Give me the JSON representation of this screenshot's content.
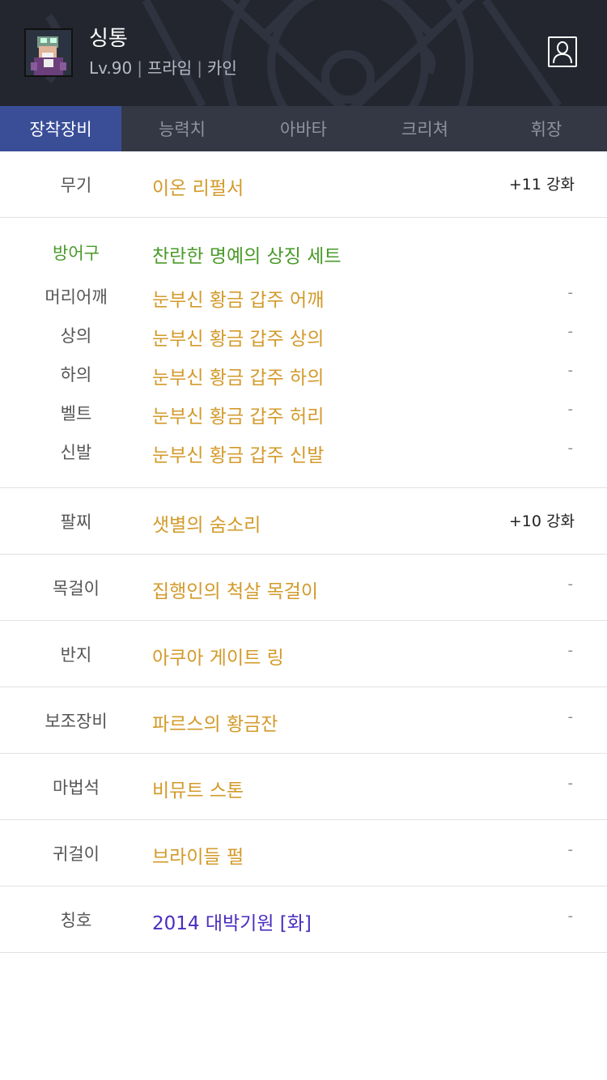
{
  "character": {
    "name": "싱통",
    "level": "Lv.90",
    "job": "프라임",
    "server": "카인",
    "separator": "|"
  },
  "tabs": [
    {
      "label": "장착장비",
      "active": true
    },
    {
      "label": "능력치",
      "active": false
    },
    {
      "label": "아바타",
      "active": false
    },
    {
      "label": "크리쳐",
      "active": false
    },
    {
      "label": "휘장",
      "active": false
    }
  ],
  "equipment": {
    "weapon": {
      "category": "무기",
      "name": "이온 리펄서",
      "enhance": "+11 강화"
    },
    "armor": {
      "category": "방어구",
      "set_name": "찬란한 명예의 상징 세트",
      "pieces": [
        {
          "category": "머리어깨",
          "name": "눈부신 황금 갑주 어깨",
          "enhance": "-"
        },
        {
          "category": "상의",
          "name": "눈부신 황금 갑주 상의",
          "enhance": "-"
        },
        {
          "category": "하의",
          "name": "눈부신 황금 갑주 하의",
          "enhance": "-"
        },
        {
          "category": "벨트",
          "name": "눈부신 황금 갑주 허리",
          "enhance": "-"
        },
        {
          "category": "신발",
          "name": "눈부신 황금 갑주 신발",
          "enhance": "-"
        }
      ]
    },
    "bracelet": {
      "category": "팔찌",
      "name": "샛별의 숨소리",
      "enhance": "+10 강화"
    },
    "necklace": {
      "category": "목걸이",
      "name": "집행인의 척살 목걸이",
      "enhance": "-"
    },
    "ring": {
      "category": "반지",
      "name": "아쿠아 게이트 링",
      "enhance": "-"
    },
    "subequip": {
      "category": "보조장비",
      "name": "파르스의 황금잔",
      "enhance": "-"
    },
    "magicstone": {
      "category": "마법석",
      "name": "비뮤트 스톤",
      "enhance": "-"
    },
    "earring": {
      "category": "귀걸이",
      "name": "브라이들 펄",
      "enhance": "-"
    },
    "title": {
      "category": "칭호",
      "name": "2014 대박기원 [화]",
      "enhance": "-"
    }
  },
  "colors": {
    "header_bg": "#23262f",
    "tab_bar_bg": "#343845",
    "tab_active_bg": "#3a4e98",
    "item_gold": "#d39a2a",
    "set_green": "#4a9a2a",
    "title_purple": "#4a2cc0"
  },
  "icons": {
    "avatar": "character-portrait",
    "profile": "person-profile-icon"
  }
}
